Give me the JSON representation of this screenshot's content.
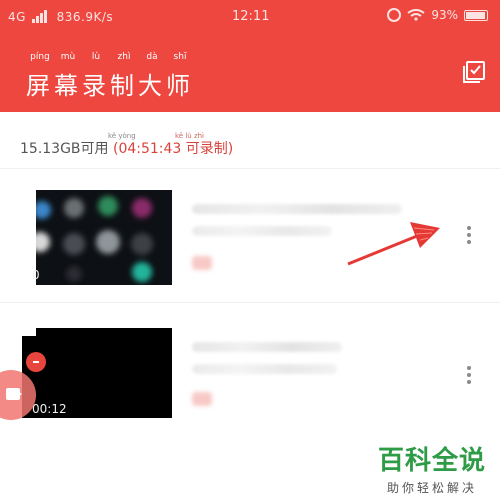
{
  "status_bar": {
    "network": "4G",
    "speed": "836.9K/s",
    "time": "12:11",
    "battery": "93%",
    "battery_level": 0.93
  },
  "app": {
    "title": "屏幕录制大师",
    "title_pinyin": [
      "píng",
      "mù",
      "lù",
      "zhì",
      "dà",
      "shī"
    ]
  },
  "storage": {
    "free_space": "15.13GB",
    "free_label": "可用",
    "free_pinyin": "kě yòng",
    "remaining_time": "(04:51:43 可录制)",
    "remaining_pinyin": "kě lù zhì"
  },
  "recordings": [
    {
      "duration": "0",
      "menu": "more-vert-icon"
    },
    {
      "duration": "00:12",
      "menu": "more-vert-icon"
    }
  ],
  "watermark": {
    "title": "百科全说",
    "subtitle": "助你轻松解决"
  },
  "colors": {
    "header": "#ee4740",
    "accent_text": "#d9433b",
    "watermark": "#2e9b46",
    "arrow": "#e53935"
  }
}
